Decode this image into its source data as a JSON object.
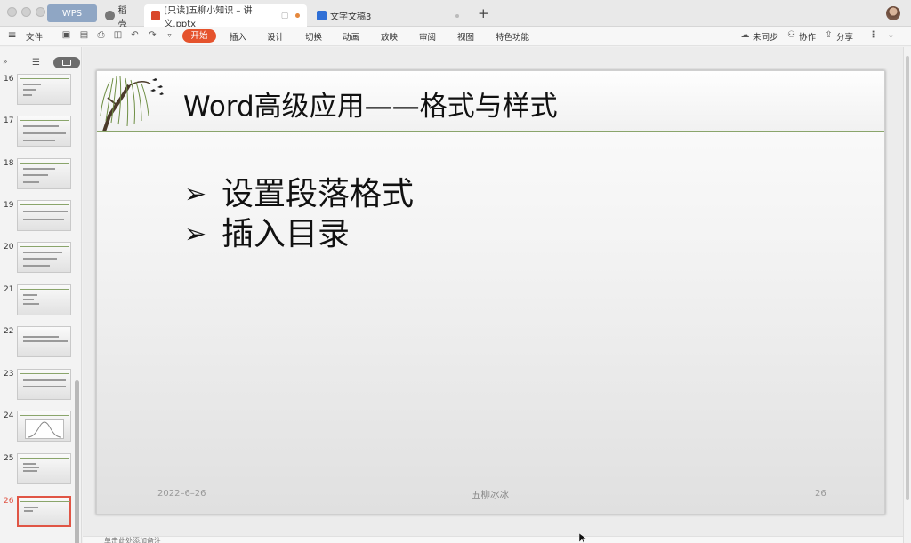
{
  "titlebar": {
    "tabs": [
      {
        "label": "WPS"
      },
      {
        "label": "稻壳"
      },
      {
        "label": "[只读]五柳小知识 – 讲义.pptx"
      },
      {
        "label": "文字文稿3"
      }
    ]
  },
  "toolbar": {
    "file_label": "文件",
    "start_label": "开始",
    "menus": [
      "插入",
      "设计",
      "切换",
      "动画",
      "放映",
      "审阅",
      "视图",
      "特色功能"
    ],
    "unsynced_label": "未同步",
    "collab_label": "协作",
    "share_label": "分享"
  },
  "thumbnails": {
    "numbers": [
      "16",
      "17",
      "18",
      "19",
      "20",
      "21",
      "22",
      "23",
      "24",
      "25",
      "26"
    ],
    "active": "26"
  },
  "slide": {
    "title": "Word高级应用——格式与样式",
    "bullet_mark": "➢",
    "bullets": [
      "设置段落格式",
      "插入目录"
    ],
    "footer_date": "2022–6–26",
    "footer_center": "五柳冰冰",
    "footer_number": "26"
  },
  "notes": {
    "placeholder": "单击此处添加备注"
  },
  "colors": {
    "accent": "#e5532d",
    "title_line": "#8aa56b",
    "active_thumb": "#e05545"
  }
}
